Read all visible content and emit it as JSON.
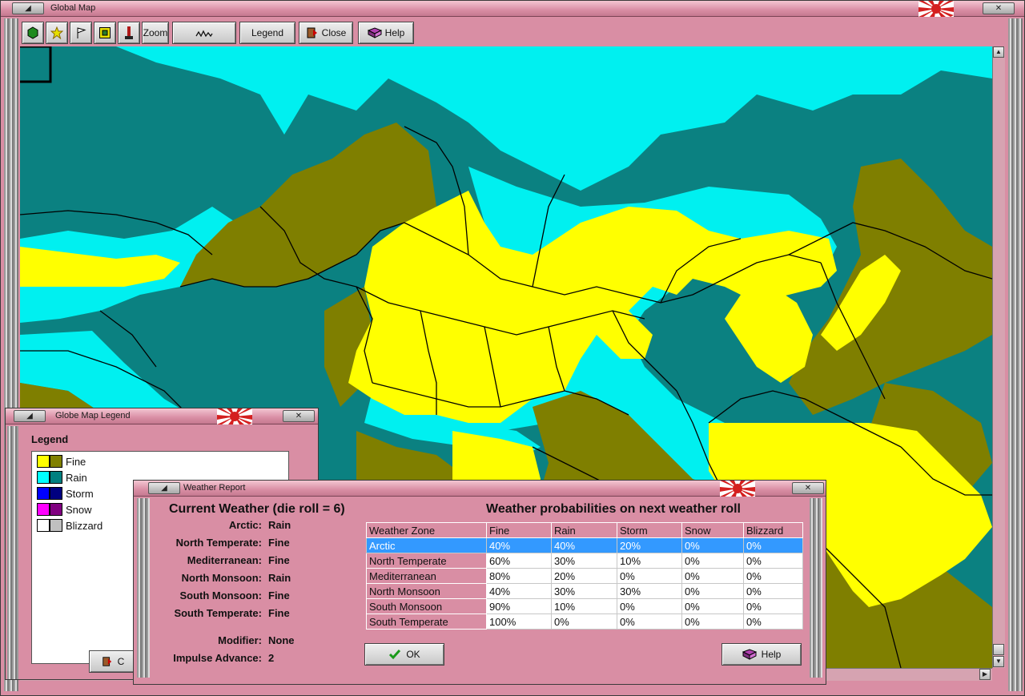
{
  "global_map": {
    "title": "Global Map",
    "toolbar": {
      "zoom_label": "Zoom",
      "legend_label": "Legend",
      "close_label": "Close",
      "help_label": "Help"
    }
  },
  "legend_window": {
    "title": "Globe Map Legend",
    "heading": "Legend",
    "items": [
      {
        "label": "Fine",
        "colors": [
          "#ffff00",
          "#808000"
        ]
      },
      {
        "label": "Rain",
        "colors": [
          "#00ffff",
          "#008080"
        ]
      },
      {
        "label": "Storm",
        "colors": [
          "#0000ff",
          "#000080"
        ]
      },
      {
        "label": "Snow",
        "colors": [
          "#ff00ff",
          "#800080"
        ]
      },
      {
        "label": "Blizzard",
        "colors": [
          "#ffffff",
          "#c0c0c0"
        ]
      }
    ],
    "close_label": "C"
  },
  "weather_report": {
    "title": "Weather Report",
    "current_heading": "Current Weather (die roll = 6)",
    "prob_heading": "Weather probabilities on next weather roll",
    "current": [
      {
        "zone": "Arctic:",
        "weather": "Rain"
      },
      {
        "zone": "North Temperate:",
        "weather": "Fine"
      },
      {
        "zone": "Mediterranean:",
        "weather": "Fine"
      },
      {
        "zone": "North Monsoon:",
        "weather": "Rain"
      },
      {
        "zone": "South Monsoon:",
        "weather": "Fine"
      },
      {
        "zone": "South Temperate:",
        "weather": "Fine"
      }
    ],
    "modifier_label": "Modifier:",
    "modifier_value": "None",
    "impulse_label": "Impulse Advance:",
    "impulse_value": "2",
    "table": {
      "headers": [
        "Weather Zone",
        "Fine",
        "Rain",
        "Storm",
        "Snow",
        "Blizzard"
      ],
      "rows": [
        [
          "Arctic",
          "40%",
          "40%",
          "20%",
          "0%",
          "0%"
        ],
        [
          "North Temperate",
          "60%",
          "30%",
          "10%",
          "0%",
          "0%"
        ],
        [
          "Mediterranean",
          "80%",
          "20%",
          "0%",
          "0%",
          "0%"
        ],
        [
          "North Monsoon",
          "40%",
          "30%",
          "30%",
          "0%",
          "0%"
        ],
        [
          "South Monsoon",
          "90%",
          "10%",
          "0%",
          "0%",
          "0%"
        ],
        [
          "South Temperate",
          "100%",
          "0%",
          "0%",
          "0%",
          "0%"
        ]
      ]
    },
    "ok_label": "OK",
    "help_label": "Help"
  },
  "colors": {
    "fine_light": "#ffff00",
    "fine_dark": "#808000",
    "rain_light": "#00ffff",
    "rain_dark": "#008080",
    "window": "#d98ea4",
    "selection": "#3399ff"
  }
}
